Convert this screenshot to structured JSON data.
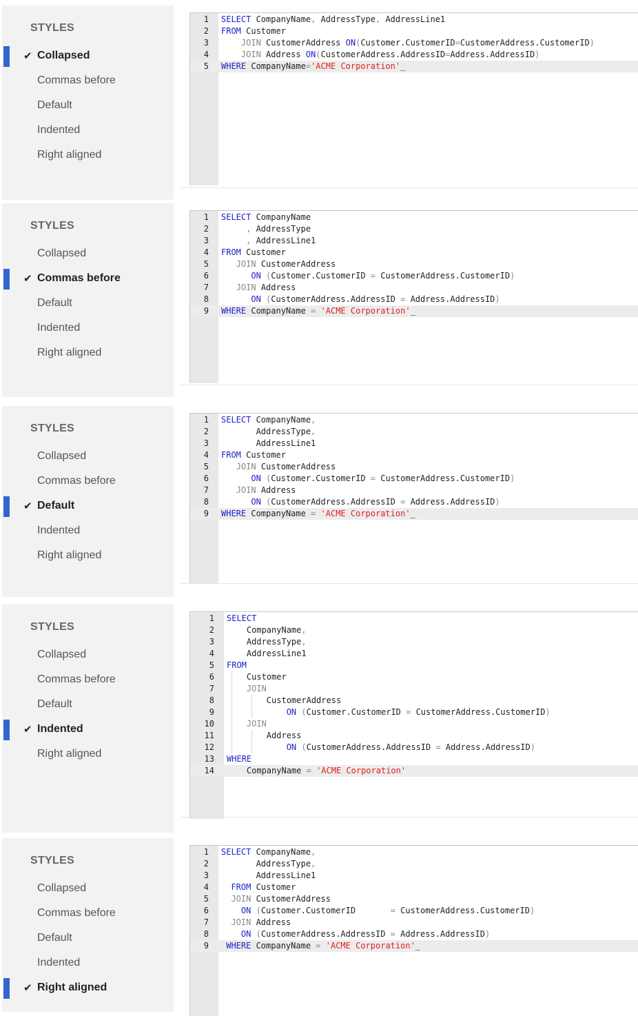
{
  "panels": [
    {
      "heading": "STYLES",
      "options": [
        "Collapsed",
        "Commas before",
        "Default",
        "Indented",
        "Right aligned"
      ],
      "selected": "Collapsed",
      "lines": [
        [
          [
            "k",
            "SELECT"
          ],
          [
            "t",
            " CompanyName"
          ],
          [
            "d",
            ","
          ],
          [
            "t",
            " AddressType"
          ],
          [
            "d",
            ","
          ],
          [
            "t",
            " AddressLine1"
          ]
        ],
        [
          [
            "k",
            "FROM"
          ],
          [
            "t",
            " Customer"
          ]
        ],
        [
          [
            "t",
            "    "
          ],
          [
            "d",
            "JOIN"
          ],
          [
            "t",
            " CustomerAddress "
          ],
          [
            "k",
            "ON"
          ],
          [
            "d",
            "("
          ],
          [
            "t",
            "Customer.CustomerID"
          ],
          [
            "d",
            "="
          ],
          [
            "t",
            "CustomerAddress.CustomerID"
          ],
          [
            "d",
            ")"
          ]
        ],
        [
          [
            "t",
            "    "
          ],
          [
            "d",
            "JOIN"
          ],
          [
            "t",
            " Address "
          ],
          [
            "k",
            "ON"
          ],
          [
            "d",
            "("
          ],
          [
            "t",
            "CustomerAddress.AddressID"
          ],
          [
            "d",
            "="
          ],
          [
            "t",
            "Address.AddressID"
          ],
          [
            "d",
            ")"
          ]
        ],
        [
          [
            "k",
            "WHERE"
          ],
          [
            "t",
            " CompanyName"
          ],
          [
            "d",
            "="
          ],
          [
            "s",
            "'ACME Corporation'"
          ]
        ]
      ],
      "current_line": 5
    },
    {
      "heading": "STYLES",
      "options": [
        "Collapsed",
        "Commas before",
        "Default",
        "Indented",
        "Right aligned"
      ],
      "selected": "Commas before",
      "lines": [
        [
          [
            "k",
            "SELECT"
          ],
          [
            "t",
            " CompanyName"
          ]
        ],
        [
          [
            "t",
            "     "
          ],
          [
            "d",
            ","
          ],
          [
            "t",
            " AddressType"
          ]
        ],
        [
          [
            "t",
            "     "
          ],
          [
            "d",
            ","
          ],
          [
            "t",
            " AddressLine1"
          ]
        ],
        [
          [
            "k",
            "FROM"
          ],
          [
            "t",
            " Customer"
          ]
        ],
        [
          [
            "t",
            "   "
          ],
          [
            "d",
            "JOIN"
          ],
          [
            "t",
            " CustomerAddress"
          ]
        ],
        [
          [
            "t",
            "      "
          ],
          [
            "k",
            "ON"
          ],
          [
            "t",
            " "
          ],
          [
            "d",
            "("
          ],
          [
            "t",
            "Customer.CustomerID "
          ],
          [
            "d",
            "="
          ],
          [
            "t",
            " CustomerAddress.CustomerID"
          ],
          [
            "d",
            ")"
          ]
        ],
        [
          [
            "t",
            "   "
          ],
          [
            "d",
            "JOIN"
          ],
          [
            "t",
            " Address"
          ]
        ],
        [
          [
            "t",
            "      "
          ],
          [
            "k",
            "ON"
          ],
          [
            "t",
            " "
          ],
          [
            "d",
            "("
          ],
          [
            "t",
            "CustomerAddress.AddressID "
          ],
          [
            "d",
            "="
          ],
          [
            "t",
            " Address.AddressID"
          ],
          [
            "d",
            ")"
          ]
        ],
        [
          [
            "k",
            "WHERE"
          ],
          [
            "t",
            " CompanyName "
          ],
          [
            "d",
            "="
          ],
          [
            "t",
            " "
          ],
          [
            "s",
            "'ACME Corporation'"
          ]
        ]
      ],
      "current_line": 9
    },
    {
      "heading": "STYLES",
      "options": [
        "Collapsed",
        "Commas before",
        "Default",
        "Indented",
        "Right aligned"
      ],
      "selected": "Default",
      "lines": [
        [
          [
            "k",
            "SELECT"
          ],
          [
            "t",
            " CompanyName"
          ],
          [
            "d",
            ","
          ]
        ],
        [
          [
            "t",
            "       AddressType"
          ],
          [
            "d",
            ","
          ]
        ],
        [
          [
            "t",
            "       AddressLine1"
          ]
        ],
        [
          [
            "k",
            "FROM"
          ],
          [
            "t",
            " Customer"
          ]
        ],
        [
          [
            "t",
            "   "
          ],
          [
            "d",
            "JOIN"
          ],
          [
            "t",
            " CustomerAddress"
          ]
        ],
        [
          [
            "t",
            "      "
          ],
          [
            "k",
            "ON"
          ],
          [
            "t",
            " "
          ],
          [
            "d",
            "("
          ],
          [
            "t",
            "Customer.CustomerID "
          ],
          [
            "d",
            "="
          ],
          [
            "t",
            " CustomerAddress.CustomerID"
          ],
          [
            "d",
            ")"
          ]
        ],
        [
          [
            "t",
            "   "
          ],
          [
            "d",
            "JOIN"
          ],
          [
            "t",
            " Address"
          ]
        ],
        [
          [
            "t",
            "      "
          ],
          [
            "k",
            "ON"
          ],
          [
            "t",
            " "
          ],
          [
            "d",
            "("
          ],
          [
            "t",
            "CustomerAddress.AddressID "
          ],
          [
            "d",
            "="
          ],
          [
            "t",
            " Address.AddressID"
          ],
          [
            "d",
            ")"
          ]
        ],
        [
          [
            "k",
            "WHERE"
          ],
          [
            "t",
            " CompanyName "
          ],
          [
            "d",
            "="
          ],
          [
            "t",
            " "
          ],
          [
            "s",
            "'ACME Corporation'"
          ]
        ]
      ],
      "current_line": 9
    },
    {
      "heading": "STYLES",
      "options": [
        "Collapsed",
        "Commas before",
        "Default",
        "Indented",
        "Right aligned"
      ],
      "selected": "Indented",
      "lines": [
        [
          [
            "k",
            "SELECT"
          ]
        ],
        [
          [
            "t",
            "    CompanyName"
          ],
          [
            "d",
            ","
          ]
        ],
        [
          [
            "t",
            "    AddressType"
          ],
          [
            "d",
            ","
          ]
        ],
        [
          [
            "t",
            "    AddressLine1"
          ]
        ],
        [
          [
            "k",
            "FROM"
          ]
        ],
        [
          [
            "t",
            "    Customer"
          ]
        ],
        [
          [
            "t",
            "    "
          ],
          [
            "d",
            "JOIN"
          ]
        ],
        [
          [
            "t",
            "        CustomerAddress"
          ]
        ],
        [
          [
            "t",
            "            "
          ],
          [
            "k",
            "ON"
          ],
          [
            "t",
            " "
          ],
          [
            "d",
            "("
          ],
          [
            "t",
            "Customer.CustomerID "
          ],
          [
            "d",
            "="
          ],
          [
            "t",
            " CustomerAddress.CustomerID"
          ],
          [
            "d",
            ")"
          ]
        ],
        [
          [
            "t",
            "    "
          ],
          [
            "d",
            "JOIN"
          ]
        ],
        [
          [
            "t",
            "        Address"
          ]
        ],
        [
          [
            "t",
            "            "
          ],
          [
            "k",
            "ON"
          ],
          [
            "t",
            " "
          ],
          [
            "d",
            "("
          ],
          [
            "t",
            "CustomerAddress.AddressID "
          ],
          [
            "d",
            "="
          ],
          [
            "t",
            " Address.AddressID"
          ],
          [
            "d",
            ")"
          ]
        ],
        [
          [
            "k",
            "WHERE"
          ]
        ],
        [
          [
            "t",
            "    CompanyName "
          ],
          [
            "d",
            "="
          ],
          [
            "t",
            " "
          ],
          [
            "s",
            "'ACME Corporation'"
          ]
        ]
      ],
      "current_line": 14
    },
    {
      "heading": "STYLES",
      "options": [
        "Collapsed",
        "Commas before",
        "Default",
        "Indented",
        "Right aligned"
      ],
      "selected": "Right aligned",
      "lines": [
        [
          [
            "k",
            "SELECT"
          ],
          [
            "t",
            " CompanyName"
          ],
          [
            "d",
            ","
          ]
        ],
        [
          [
            "t",
            "       AddressType"
          ],
          [
            "d",
            ","
          ]
        ],
        [
          [
            "t",
            "       AddressLine1"
          ]
        ],
        [
          [
            "t",
            "  "
          ],
          [
            "k",
            "FROM"
          ],
          [
            "t",
            " Customer"
          ]
        ],
        [
          [
            "t",
            "  "
          ],
          [
            "d",
            "JOIN"
          ],
          [
            "t",
            " CustomerAddress"
          ]
        ],
        [
          [
            "t",
            "    "
          ],
          [
            "k",
            "ON"
          ],
          [
            "t",
            " "
          ],
          [
            "d",
            "("
          ],
          [
            "t",
            "Customer.CustomerID       "
          ],
          [
            "d",
            "="
          ],
          [
            "t",
            " CustomerAddress.CustomerID"
          ],
          [
            "d",
            ")"
          ]
        ],
        [
          [
            "t",
            "  "
          ],
          [
            "d",
            "JOIN"
          ],
          [
            "t",
            " Address"
          ]
        ],
        [
          [
            "t",
            "    "
          ],
          [
            "k",
            "ON"
          ],
          [
            "t",
            " "
          ],
          [
            "d",
            "("
          ],
          [
            "t",
            "CustomerAddress.AddressID "
          ],
          [
            "d",
            "="
          ],
          [
            "t",
            " Address.AddressID"
          ],
          [
            "d",
            ")"
          ]
        ],
        [
          [
            "t",
            " "
          ],
          [
            "k",
            "WHERE"
          ],
          [
            "t",
            " CompanyName "
          ],
          [
            "d",
            "="
          ],
          [
            "t",
            " "
          ],
          [
            "s",
            "'ACME Corporation'"
          ]
        ]
      ],
      "current_line": 9
    }
  ],
  "colors": {
    "accent": "#3366cc",
    "keyword": "#1c22c8",
    "string": "#e02020",
    "operator": "#888888",
    "sidebar_bg": "#f2f2f2",
    "gutter_bg": "#e8e8e8",
    "current_line_bg": "#ececec"
  },
  "icons": {
    "selected_marker": "checkmark-icon"
  }
}
